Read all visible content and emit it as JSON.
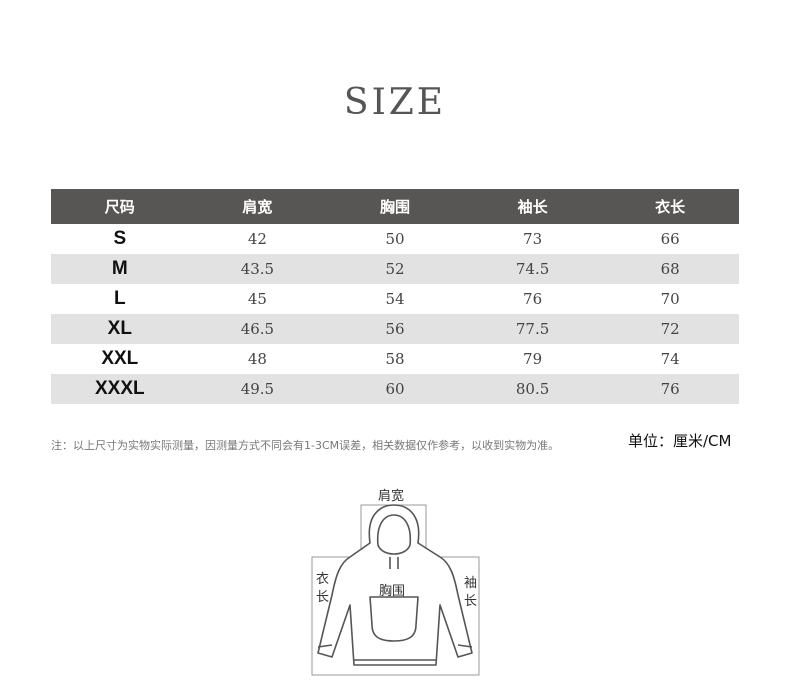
{
  "title": "SIZE",
  "table": {
    "headers": [
      "尺码",
      "肩宽",
      "胸围",
      "袖长",
      "衣长"
    ],
    "rows": [
      [
        "S",
        "42",
        "50",
        "73",
        "66"
      ],
      [
        "M",
        "43.5",
        "52",
        "74.5",
        "68"
      ],
      [
        "L",
        "45",
        "54",
        "76",
        "70"
      ],
      [
        "XL",
        "46.5",
        "56",
        "77.5",
        "72"
      ],
      [
        "XXL",
        "48",
        "58",
        "79",
        "74"
      ],
      [
        "XXXL",
        "49.5",
        "60",
        "80.5",
        "76"
      ]
    ]
  },
  "note": "注：以上尺寸为实物实际测量，因测量方式不同会有1-3CM误差，相关数据仅作参考，以收到实物为准。",
  "unit": "单位：厘米/CM",
  "diagram": {
    "shoulder": "肩宽",
    "length_1": "衣",
    "length_2": "长",
    "chest": "胸围",
    "sleeve_1": "袖",
    "sleeve_2": "长"
  }
}
